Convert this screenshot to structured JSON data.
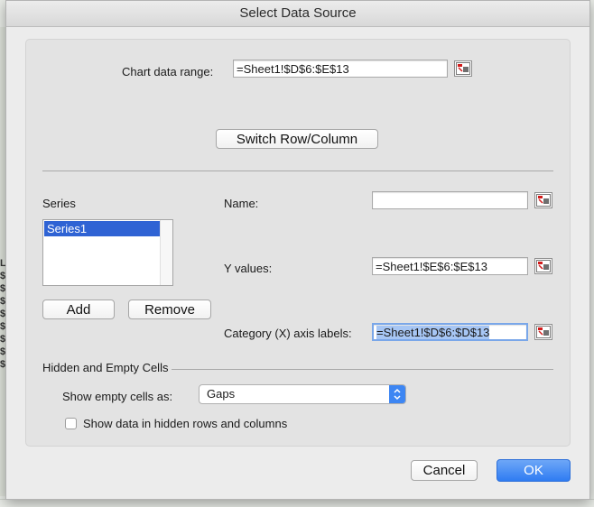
{
  "window": {
    "title": "Select Data Source"
  },
  "chart_range": {
    "label": "Chart data range:",
    "value": "=Sheet1!$D$6:$E$13"
  },
  "switch_button": {
    "label": "Switch Row/Column"
  },
  "series": {
    "label": "Series",
    "items": [
      "Series1"
    ],
    "add_label": "Add",
    "remove_label": "Remove"
  },
  "name_field": {
    "label": "Name:",
    "value": ""
  },
  "y_values": {
    "label": "Y values:",
    "value": "=Sheet1!$E$6:$E$13"
  },
  "category_labels": {
    "label": "Category (X) axis labels:",
    "value": "=Sheet1!$D$6:$D$13"
  },
  "hidden_empty": {
    "title": "Hidden and Empty Cells",
    "show_empty_label": "Show empty cells as:",
    "show_empty_value": "Gaps",
    "show_hidden_label": "Show data in hidden rows and columns",
    "show_hidden_checked": false
  },
  "footer": {
    "cancel_label": "Cancel",
    "ok_label": "OK"
  },
  "background_sheet": {
    "col_letter": "L",
    "cell_symbols": [
      "$",
      "$",
      "$",
      "$",
      "$",
      "$",
      "$",
      "$"
    ]
  },
  "colors": {
    "accent": "#2f7cf2",
    "selection": "#2f63d4"
  }
}
